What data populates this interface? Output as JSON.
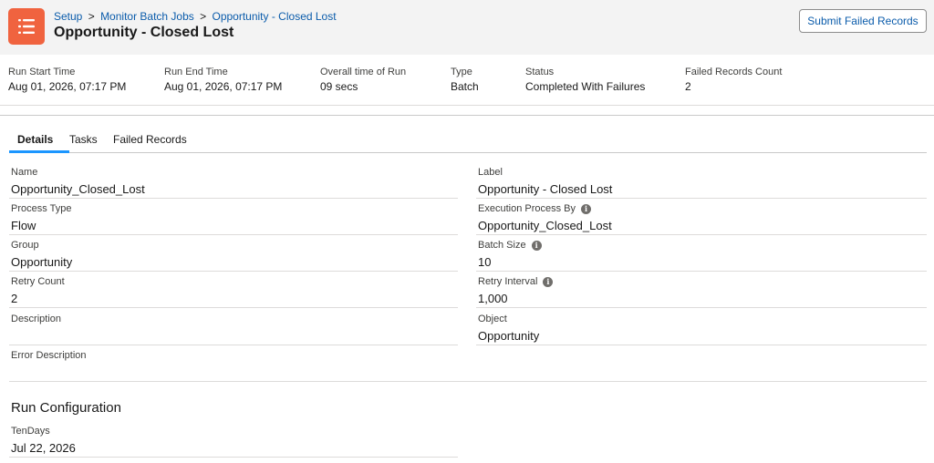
{
  "header": {
    "icon": "list-icon",
    "breadcrumb": [
      "Setup",
      "Monitor Batch Jobs",
      "Opportunity - Closed Lost"
    ],
    "separator": ">",
    "title": "Opportunity - Closed Lost",
    "submit_label": "Submit Failed Records"
  },
  "summary": [
    {
      "label": "Run Start Time",
      "value": "Aug 01, 2026, 07:17 PM"
    },
    {
      "label": "Run End Time",
      "value": "Aug 01, 2026, 07:17 PM"
    },
    {
      "label": "Overall time of Run",
      "value": "09 secs"
    },
    {
      "label": "Type",
      "value": "Batch"
    },
    {
      "label": "Status",
      "value": "Completed With Failures"
    },
    {
      "label": "Failed Records Count",
      "value": "2"
    }
  ],
  "tabs": [
    "Details",
    "Tasks",
    "Failed Records"
  ],
  "details": {
    "left": [
      {
        "label": "Name",
        "value": "Opportunity_Closed_Lost"
      },
      {
        "label": "Process Type",
        "value": "Flow"
      },
      {
        "label": "Group",
        "value": "Opportunity"
      },
      {
        "label": "Retry Count",
        "value": "2"
      },
      {
        "label": "Description",
        "value": ""
      },
      {
        "label": "Error Description",
        "value": ""
      }
    ],
    "right": [
      {
        "label": "Label",
        "value": "Opportunity - Closed Lost",
        "info": false
      },
      {
        "label": "Execution Process By",
        "value": "Opportunity_Closed_Lost",
        "info": true
      },
      {
        "label": "Batch Size",
        "value": "10",
        "info": true
      },
      {
        "label": "Retry Interval",
        "value": "1,000",
        "info": true
      },
      {
        "label": "Object",
        "value": "Opportunity",
        "info": false
      }
    ]
  },
  "info_glyph": "i",
  "run_config": {
    "title": "Run Configuration",
    "fields": [
      {
        "label": "TenDays",
        "value": "Jul 22, 2026"
      }
    ]
  },
  "colors": {
    "brand_icon": "#f0633f",
    "link": "#0b5cab",
    "active_tab_underline": "#1b96ff"
  }
}
